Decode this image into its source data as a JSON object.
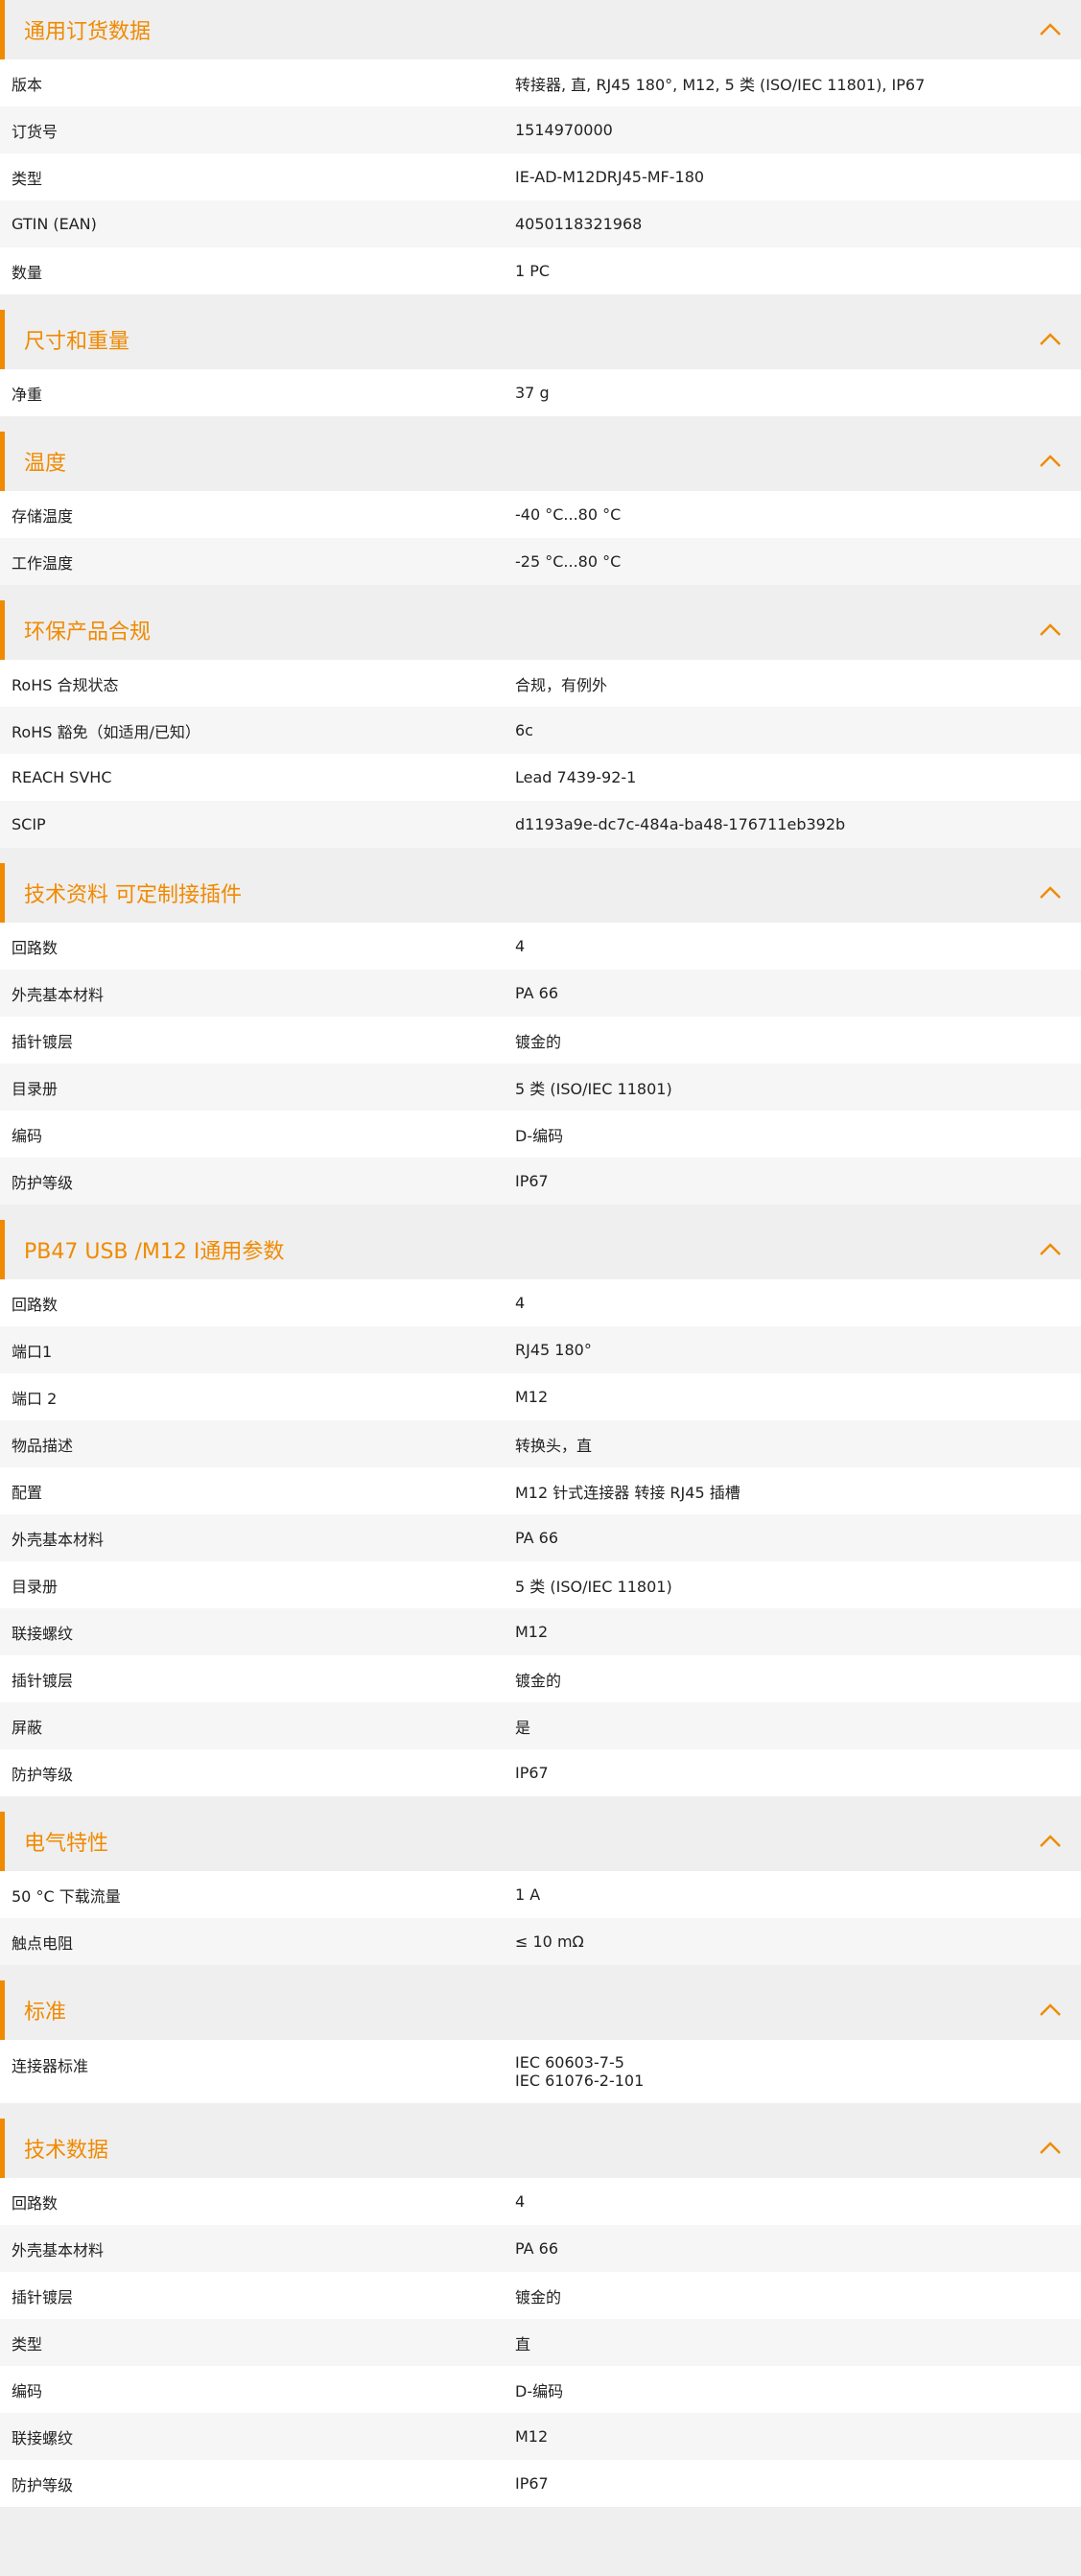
{
  "colors": {
    "accent": "#f08a00",
    "header_bg": "#efefef"
  },
  "icons": {
    "collapse": "chevron-up-icon"
  },
  "sections": [
    {
      "title": "通用订货数据",
      "rows": [
        {
          "label": "版本",
          "value": "转接器, 直, RJ45 180°, M12, 5 类 (ISO/IEC 11801), IP67"
        },
        {
          "label": "订货号",
          "value": "1514970000"
        },
        {
          "label": "类型",
          "value": "IE-AD-M12DRJ45-MF-180"
        },
        {
          "label": "GTIN (EAN)",
          "value": "4050118321968"
        },
        {
          "label": "数量",
          "value": "1 PC"
        }
      ]
    },
    {
      "title": "尺寸和重量",
      "rows": [
        {
          "label": "净重",
          "value": "37 g"
        }
      ]
    },
    {
      "title": "温度",
      "rows": [
        {
          "label": "存储温度",
          "value": "-40 °C...80 °C"
        },
        {
          "label": "工作温度",
          "value": "-25 °C...80 °C"
        }
      ]
    },
    {
      "title": "环保产品合规",
      "rows": [
        {
          "label": "RoHS 合规状态",
          "value": "合规，有例外"
        },
        {
          "label": "RoHS 豁免（如适用/已知）",
          "value": "6c"
        },
        {
          "label": "REACH SVHC",
          "value": "Lead 7439-92-1"
        },
        {
          "label": "SCIP",
          "value": "d1193a9e-dc7c-484a-ba48-176711eb392b"
        }
      ]
    },
    {
      "title": "技术资料 可定制接插件",
      "rows": [
        {
          "label": "回路数",
          "value": "4"
        },
        {
          "label": "外壳基本材料",
          "value": "PA 66"
        },
        {
          "label": "插针镀层",
          "value": "镀金的"
        },
        {
          "label": "目录册",
          "value": "5 类 (ISO/IEC 11801)"
        },
        {
          "label": "编码",
          "value": "D-编码"
        },
        {
          "label": "防护等级",
          "value": "IP67"
        }
      ]
    },
    {
      "title": "PB47 USB /M12 I通用参数",
      "rows": [
        {
          "label": "回路数",
          "value": "4"
        },
        {
          "label": "端口1",
          "value": "RJ45 180°"
        },
        {
          "label": "端口 2",
          "value": "M12"
        },
        {
          "label": "物品描述",
          "value": "转换头，直"
        },
        {
          "label": "配置",
          "value": "M12 针式连接器 转接 RJ45 插槽"
        },
        {
          "label": "外壳基本材料",
          "value": "PA 66"
        },
        {
          "label": "目录册",
          "value": "5 类 (ISO/IEC 11801)"
        },
        {
          "label": "联接螺纹",
          "value": "M12"
        },
        {
          "label": "插针镀层",
          "value": "镀金的"
        },
        {
          "label": "屏蔽",
          "value": "是"
        },
        {
          "label": "防护等级",
          "value": "IP67"
        }
      ]
    },
    {
      "title": "电气特性",
      "rows": [
        {
          "label": "50 °C 下载流量",
          "value": "1 A"
        },
        {
          "label": "触点电阻",
          "value": "≤ 10 mΩ"
        }
      ]
    },
    {
      "title": "标准",
      "rows": [
        {
          "label": "连接器标准",
          "lines": [
            "IEC 60603-7-5",
            "IEC 61076-2-101"
          ]
        }
      ]
    },
    {
      "title": "技术数据",
      "rows": [
        {
          "label": "回路数",
          "value": "4"
        },
        {
          "label": "外壳基本材料",
          "value": "PA 66"
        },
        {
          "label": "插针镀层",
          "value": "镀金的"
        },
        {
          "label": "类型",
          "value": "直"
        },
        {
          "label": "编码",
          "value": "D-编码"
        },
        {
          "label": "联接螺纹",
          "value": "M12"
        },
        {
          "label": "防护等级",
          "value": "IP67"
        }
      ]
    }
  ]
}
